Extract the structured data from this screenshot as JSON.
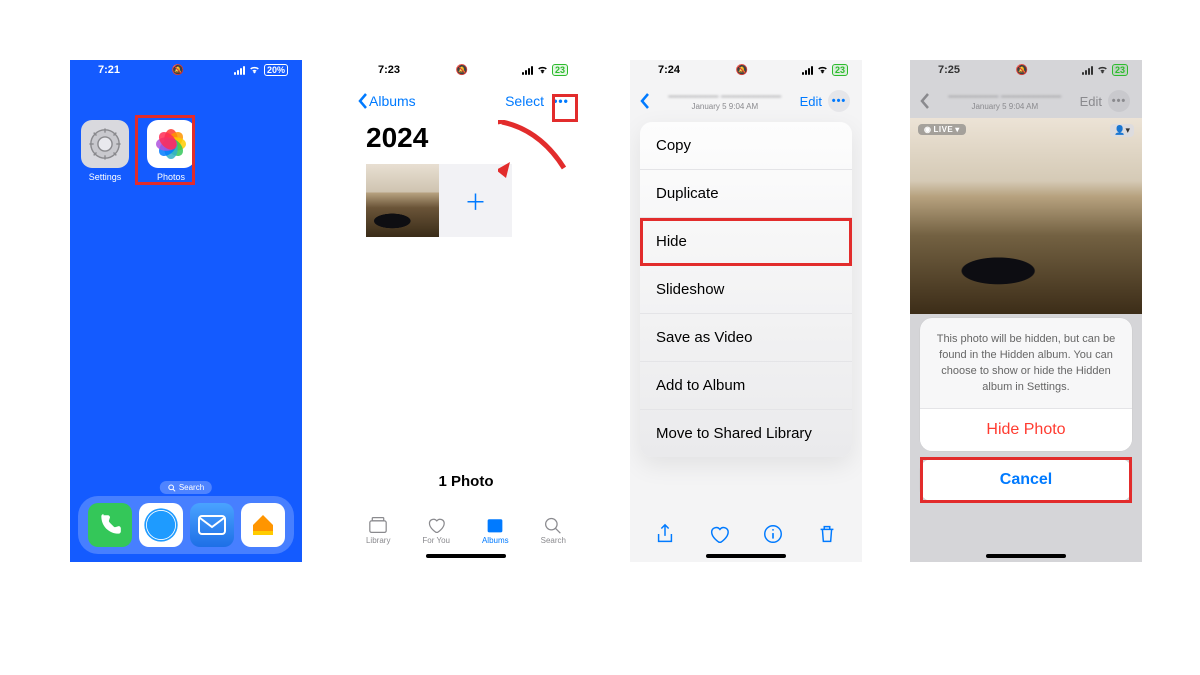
{
  "phones": {
    "p1": {
      "time": "7:21",
      "battery": "20%",
      "apps": {
        "settings": "Settings",
        "photos": "Photos"
      },
      "search": "Search"
    },
    "p2": {
      "time": "7:23",
      "battery": "23",
      "back": "Albums",
      "select": "Select",
      "year": "2024",
      "count": "1 Photo",
      "tabs": {
        "library": "Library",
        "foryou": "For You",
        "albums": "Albums",
        "search": "Search"
      }
    },
    "p3": {
      "time": "7:24",
      "battery": "23",
      "subtitle": "January 5  9:04 AM",
      "edit": "Edit",
      "menu": [
        "Copy",
        "Duplicate",
        "Hide",
        "Slideshow",
        "Save as Video",
        "Add to Album",
        "Move to Shared Library"
      ]
    },
    "p4": {
      "time": "7:25",
      "battery": "23",
      "subtitle": "January 5  9:04 AM",
      "edit": "Edit",
      "live": "LIVE",
      "sheet_text": "This photo will be hidden, but can be found in the Hidden album. You can choose to show or hide the Hidden album in Settings.",
      "hide": "Hide Photo",
      "cancel": "Cancel"
    }
  }
}
